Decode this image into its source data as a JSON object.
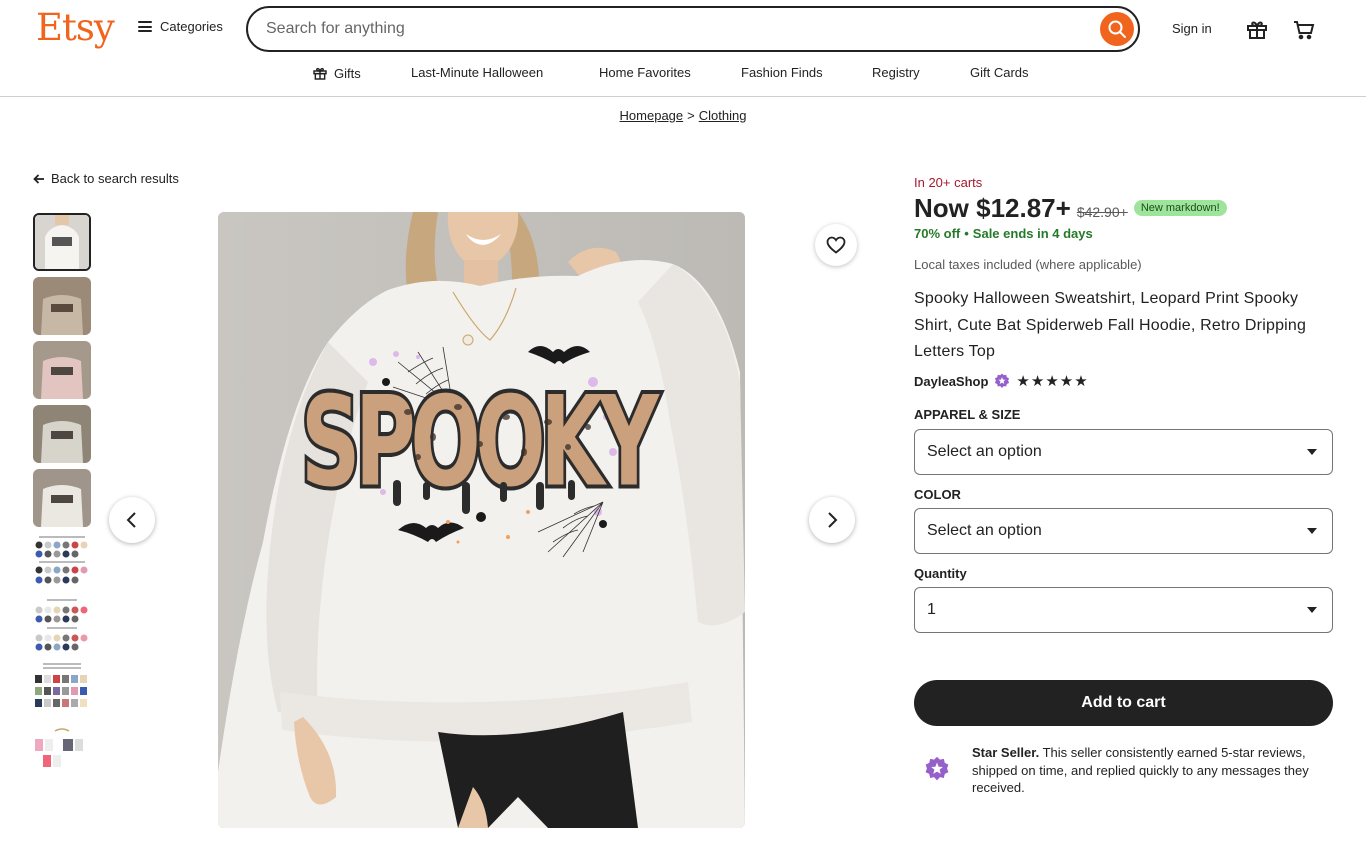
{
  "header": {
    "logo": "Etsy",
    "categories_label": "Categories",
    "search_placeholder": "Search for anything",
    "sign_in": "Sign in"
  },
  "nav": {
    "items": [
      "Gifts",
      "Last-Minute Halloween",
      "Home Favorites",
      "Fashion Finds",
      "Registry",
      "Gift Cards"
    ]
  },
  "breadcrumb": {
    "items": [
      "Homepage",
      "Clothing"
    ],
    "separator": ">"
  },
  "back_link": "Back to search results",
  "product": {
    "carts_note": "In 20+ carts",
    "price_now": "Now $12.87+",
    "price_old": "$42.90+",
    "markdown_badge": "New markdown!",
    "discount": "70% off",
    "sale_ends": "Sale ends in 4 days",
    "taxes": "Local taxes included (where applicable)",
    "title": "Spooky Halloween Sweatshirt, Leopard Print Spooky Shirt, Cute Bat Spiderweb Fall Hoodie, Retro Dripping Letters Top",
    "shop_name": "DayleaShop",
    "rating_stars": "★★★★★",
    "image_print_text": "SPOOKY"
  },
  "options": {
    "apparel_label": "APPAREL & SIZE",
    "apparel_value": "Select an option",
    "color_label": "COLOR",
    "color_value": "Select an option",
    "quantity_label": "Quantity",
    "quantity_value": "1"
  },
  "add_to_cart": "Add to cart",
  "star_seller": {
    "title": "Star Seller.",
    "text": "This seller consistently earned 5-star reviews, shipped on time, and replied quickly to any messages they received."
  },
  "colors": {
    "brand": "#f1641e",
    "carts_red": "#a61a2e",
    "sale_green": "#257a29",
    "badge_green": "#9ee59b",
    "star_seller_purple": "#9560c9"
  },
  "thumbnail_count": 9
}
